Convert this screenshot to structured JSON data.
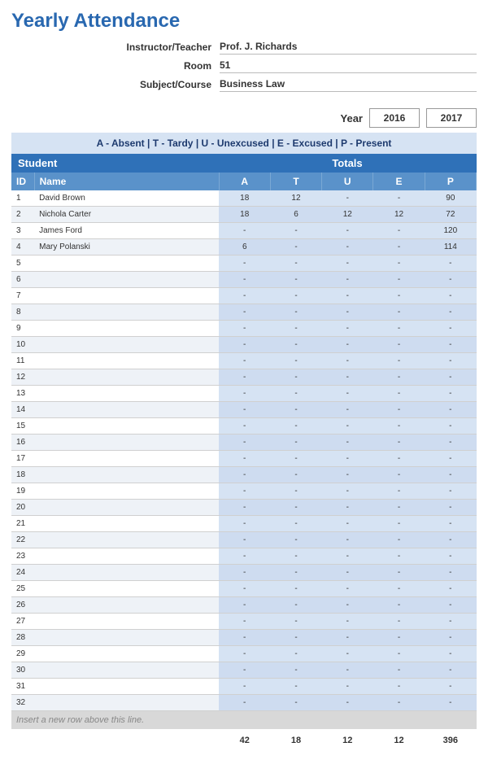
{
  "title": "Yearly Attendance",
  "header": {
    "instructor_label": "Instructor/Teacher",
    "instructor_value": "Prof. J. Richards",
    "room_label": "Room",
    "room_value": "51",
    "subject_label": "Subject/Course",
    "subject_value": "Business Law"
  },
  "year": {
    "label": "Year",
    "options": [
      "2016",
      "2017"
    ]
  },
  "legend": "A - Absent  |  T - Tardy  |  U - Unexcused  |  E - Excused  |  P - Present",
  "band": {
    "left": "Student",
    "right": "Totals"
  },
  "columns": {
    "id": "ID",
    "name": "Name",
    "a": "A",
    "t": "T",
    "u": "U",
    "e": "E",
    "p": "P"
  },
  "rows": [
    {
      "id": "1",
      "name": "David Brown",
      "a": "18",
      "t": "12",
      "u": "-",
      "e": "-",
      "p": "90"
    },
    {
      "id": "2",
      "name": "Nichola Carter",
      "a": "18",
      "t": "6",
      "u": "12",
      "e": "12",
      "p": "72"
    },
    {
      "id": "3",
      "name": "James Ford",
      "a": "-",
      "t": "-",
      "u": "-",
      "e": "-",
      "p": "120"
    },
    {
      "id": "4",
      "name": "Mary Polanski",
      "a": "6",
      "t": "-",
      "u": "-",
      "e": "-",
      "p": "114"
    },
    {
      "id": "5",
      "name": "",
      "a": "-",
      "t": "-",
      "u": "-",
      "e": "-",
      "p": "-"
    },
    {
      "id": "6",
      "name": "",
      "a": "-",
      "t": "-",
      "u": "-",
      "e": "-",
      "p": "-"
    },
    {
      "id": "7",
      "name": "",
      "a": "-",
      "t": "-",
      "u": "-",
      "e": "-",
      "p": "-"
    },
    {
      "id": "8",
      "name": "",
      "a": "-",
      "t": "-",
      "u": "-",
      "e": "-",
      "p": "-"
    },
    {
      "id": "9",
      "name": "",
      "a": "-",
      "t": "-",
      "u": "-",
      "e": "-",
      "p": "-"
    },
    {
      "id": "10",
      "name": "",
      "a": "-",
      "t": "-",
      "u": "-",
      "e": "-",
      "p": "-"
    },
    {
      "id": "11",
      "name": "",
      "a": "-",
      "t": "-",
      "u": "-",
      "e": "-",
      "p": "-"
    },
    {
      "id": "12",
      "name": "",
      "a": "-",
      "t": "-",
      "u": "-",
      "e": "-",
      "p": "-"
    },
    {
      "id": "13",
      "name": "",
      "a": "-",
      "t": "-",
      "u": "-",
      "e": "-",
      "p": "-"
    },
    {
      "id": "14",
      "name": "",
      "a": "-",
      "t": "-",
      "u": "-",
      "e": "-",
      "p": "-"
    },
    {
      "id": "15",
      "name": "",
      "a": "-",
      "t": "-",
      "u": "-",
      "e": "-",
      "p": "-"
    },
    {
      "id": "16",
      "name": "",
      "a": "-",
      "t": "-",
      "u": "-",
      "e": "-",
      "p": "-"
    },
    {
      "id": "17",
      "name": "",
      "a": "-",
      "t": "-",
      "u": "-",
      "e": "-",
      "p": "-"
    },
    {
      "id": "18",
      "name": "",
      "a": "-",
      "t": "-",
      "u": "-",
      "e": "-",
      "p": "-"
    },
    {
      "id": "19",
      "name": "",
      "a": "-",
      "t": "-",
      "u": "-",
      "e": "-",
      "p": "-"
    },
    {
      "id": "20",
      "name": "",
      "a": "-",
      "t": "-",
      "u": "-",
      "e": "-",
      "p": "-"
    },
    {
      "id": "21",
      "name": "",
      "a": "-",
      "t": "-",
      "u": "-",
      "e": "-",
      "p": "-"
    },
    {
      "id": "22",
      "name": "",
      "a": "-",
      "t": "-",
      "u": "-",
      "e": "-",
      "p": "-"
    },
    {
      "id": "23",
      "name": "",
      "a": "-",
      "t": "-",
      "u": "-",
      "e": "-",
      "p": "-"
    },
    {
      "id": "24",
      "name": "",
      "a": "-",
      "t": "-",
      "u": "-",
      "e": "-",
      "p": "-"
    },
    {
      "id": "25",
      "name": "",
      "a": "-",
      "t": "-",
      "u": "-",
      "e": "-",
      "p": "-"
    },
    {
      "id": "26",
      "name": "",
      "a": "-",
      "t": "-",
      "u": "-",
      "e": "-",
      "p": "-"
    },
    {
      "id": "27",
      "name": "",
      "a": "-",
      "t": "-",
      "u": "-",
      "e": "-",
      "p": "-"
    },
    {
      "id": "28",
      "name": "",
      "a": "-",
      "t": "-",
      "u": "-",
      "e": "-",
      "p": "-"
    },
    {
      "id": "29",
      "name": "",
      "a": "-",
      "t": "-",
      "u": "-",
      "e": "-",
      "p": "-"
    },
    {
      "id": "30",
      "name": "",
      "a": "-",
      "t": "-",
      "u": "-",
      "e": "-",
      "p": "-"
    },
    {
      "id": "31",
      "name": "",
      "a": "-",
      "t": "-",
      "u": "-",
      "e": "-",
      "p": "-"
    },
    {
      "id": "32",
      "name": "",
      "a": "-",
      "t": "-",
      "u": "-",
      "e": "-",
      "p": "-"
    }
  ],
  "insert_hint": "Insert a new row above this line.",
  "totals": {
    "a": "42",
    "t": "18",
    "u": "12",
    "e": "12",
    "p": "396"
  }
}
